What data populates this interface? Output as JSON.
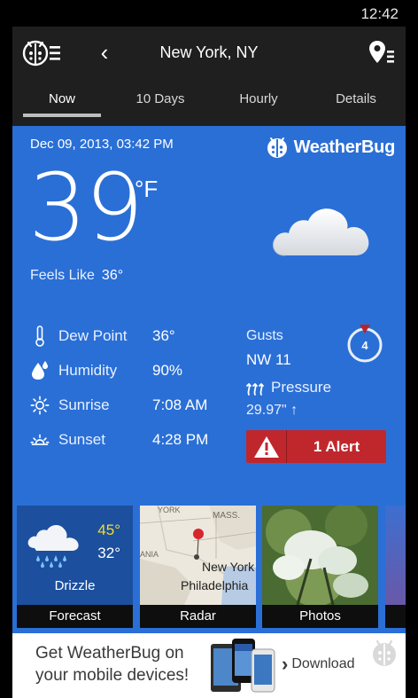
{
  "status_bar": {
    "time": "12:42"
  },
  "header": {
    "location": "New York, NY",
    "back_glyph": "‹"
  },
  "tabs": [
    {
      "label": "Now",
      "active": true
    },
    {
      "label": "10 Days",
      "active": false
    },
    {
      "label": "Hourly",
      "active": false
    },
    {
      "label": "Details",
      "active": false
    }
  ],
  "now": {
    "date": "Dec 09, 2013, 03:42 PM",
    "brand": "WeatherBug",
    "temperature": "39",
    "unit": "°F",
    "feels_like_label": "Feels Like",
    "feels_like_value": "36°",
    "condition_icon": "cloud-icon",
    "stats": [
      {
        "label": "Dew Point",
        "value": "36°",
        "icon": "thermometer-icon"
      },
      {
        "label": "Humidity",
        "value": "90%",
        "icon": "droplet-icon"
      },
      {
        "label": "Sunrise",
        "value": "7:08 AM",
        "icon": "sunrise-icon"
      },
      {
        "label": "Sunset",
        "value": "4:28 PM",
        "icon": "sunset-icon"
      }
    ],
    "gusts_label": "Gusts",
    "gusts_value": "NW 11",
    "wind_speed": "4",
    "pressure_label": "Pressure",
    "pressure_value": "29.97\"  ↑",
    "alert_label": "1 Alert"
  },
  "tiles": [
    {
      "label": "Forecast",
      "high": "45°",
      "low": "32°",
      "condition": "Drizzle"
    },
    {
      "label": "Radar",
      "map_labels": [
        "YORK",
        "MASS.",
        "ANIA",
        "New York",
        "Philadelphia"
      ]
    },
    {
      "label": "Photos"
    }
  ],
  "ad": {
    "headline": "Get WeatherBug on your mobile devices!",
    "download_label": "Download",
    "download_glyph": "›"
  },
  "colors": {
    "panel_blue": "#2a6fd6",
    "alert_red": "#c0272d",
    "forecast_high": "#f5dd2a",
    "app_bar": "#1f1f1f"
  }
}
